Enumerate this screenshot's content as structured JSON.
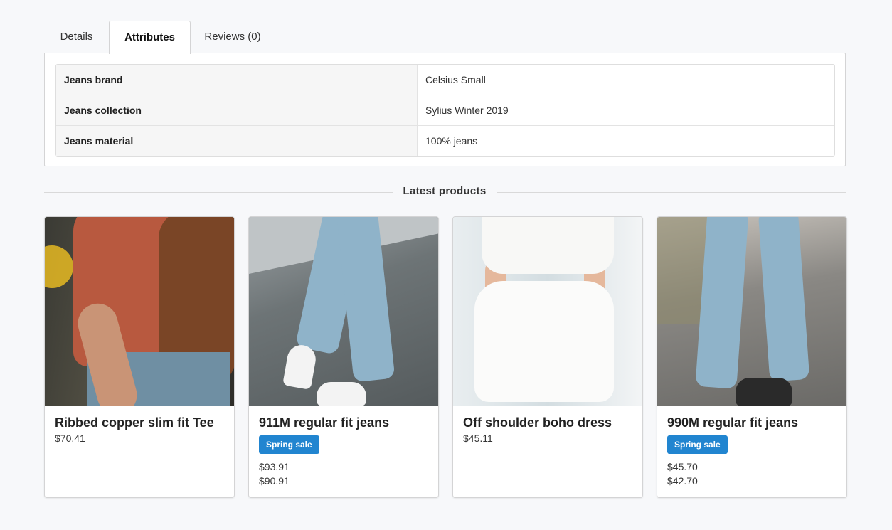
{
  "tabs": [
    {
      "label": "Details",
      "active": false
    },
    {
      "label": "Attributes",
      "active": true
    },
    {
      "label": "Reviews (0)",
      "active": false
    }
  ],
  "attributes": [
    {
      "name": "Jeans brand",
      "value": "Celsius Small"
    },
    {
      "name": "Jeans collection",
      "value": "Sylius Winter 2019"
    },
    {
      "name": "Jeans material",
      "value": "100% jeans"
    }
  ],
  "latest": {
    "title": "Latest products",
    "products": [
      {
        "name": "Ribbed copper slim fit Tee",
        "price": "$70.41"
      },
      {
        "name": "911M regular fit jeans",
        "badge": "Spring sale",
        "old_price": "$93.91",
        "price": "$90.91"
      },
      {
        "name": "Off shoulder boho dress",
        "price": "$45.11"
      },
      {
        "name": "990M regular fit jeans",
        "badge": "Spring sale",
        "old_price": "$45.70",
        "price": "$42.70"
      }
    ]
  },
  "colors": {
    "badge": "#2185d0"
  }
}
